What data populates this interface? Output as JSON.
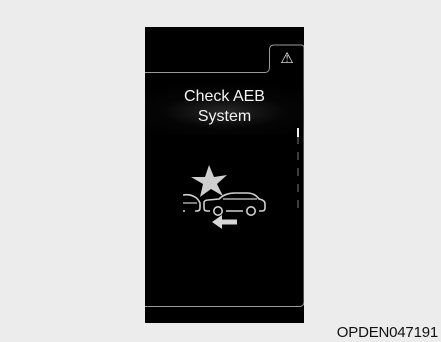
{
  "display": {
    "warning_icon": "warning-triangle-icon",
    "warning_symbol": "⚠",
    "message": {
      "line1": "Check AEB",
      "line2": "System"
    },
    "illustration_icon": "aeb-collision-icon",
    "scroll": {
      "segments": 5,
      "position": 0
    }
  },
  "figure": {
    "code": "OPDEN047191"
  },
  "colors": {
    "background": "#ececec",
    "screen": "#000000",
    "frame_line": "#9a9a9a",
    "icon": "#d8d8d8",
    "text": "#f4f4f4"
  }
}
